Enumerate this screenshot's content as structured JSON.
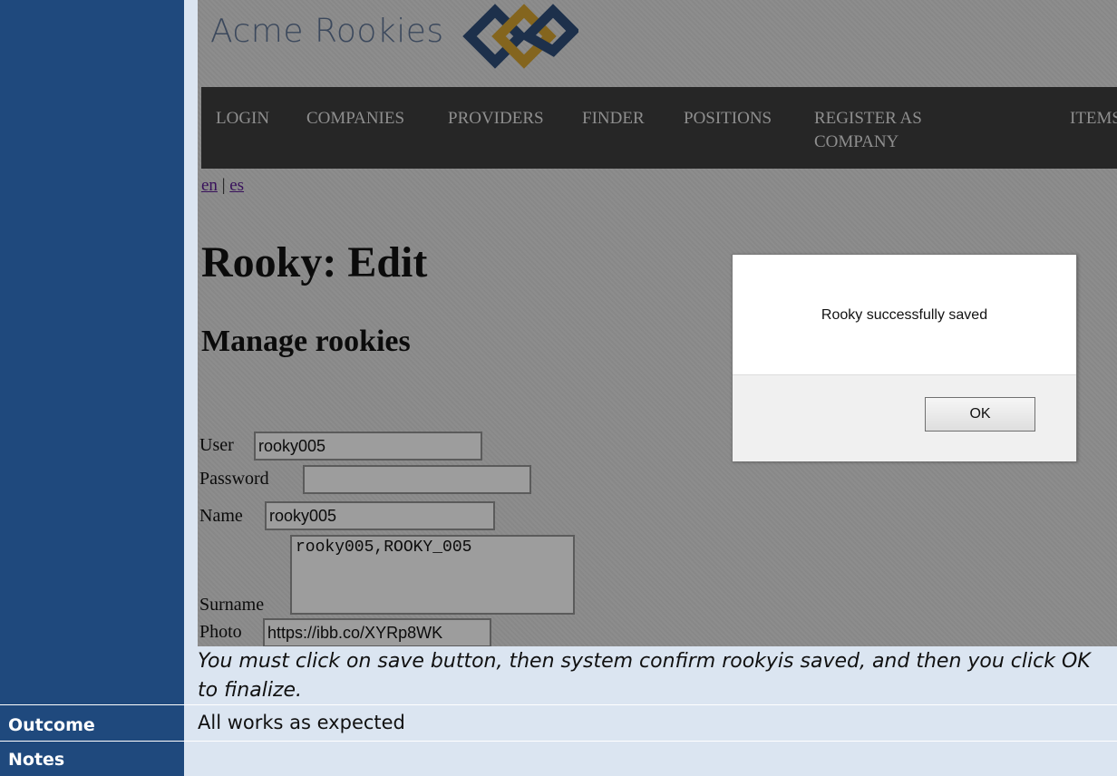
{
  "table": {
    "caption_text": "You must click on save button, then system confirm rookyis saved, and then you click OK to finalize.",
    "outcome_label": "Outcome",
    "outcome_value": "All works as expected",
    "notes_label": "Notes",
    "notes_value": ""
  },
  "screenshot": {
    "logo_text": "Acme Rookies",
    "nav": [
      "LOGIN",
      "COMPANIES",
      "PROVIDERS",
      "FINDER",
      "POSITIONS",
      "REGISTER AS",
      "COMPANY",
      "ITEMS"
    ],
    "lang_en": "en",
    "lang_sep": "|",
    "lang_es": "es",
    "page_title": "Rooky: Edit",
    "section_title": "Manage rookies",
    "form": {
      "user_label": "User",
      "user_value": "rooky005",
      "password_label": "Password",
      "password_value": "",
      "name_label": "Name",
      "name_value": "rooky005",
      "surname_label": "Surname",
      "surname_value": "rooky005,ROOKY_005",
      "photo_label": "Photo",
      "photo_value": "https://ibb.co/XYRp8WK"
    },
    "dialog": {
      "message": "Rooky successfully saved",
      "ok_label": "OK"
    }
  },
  "colors": {
    "label_column": "#1f497d",
    "value_column": "#dbe5f1",
    "navbar": "#3a3a3a",
    "logo_blue": "#2d4a73",
    "logo_gold": "#c99a2e"
  }
}
